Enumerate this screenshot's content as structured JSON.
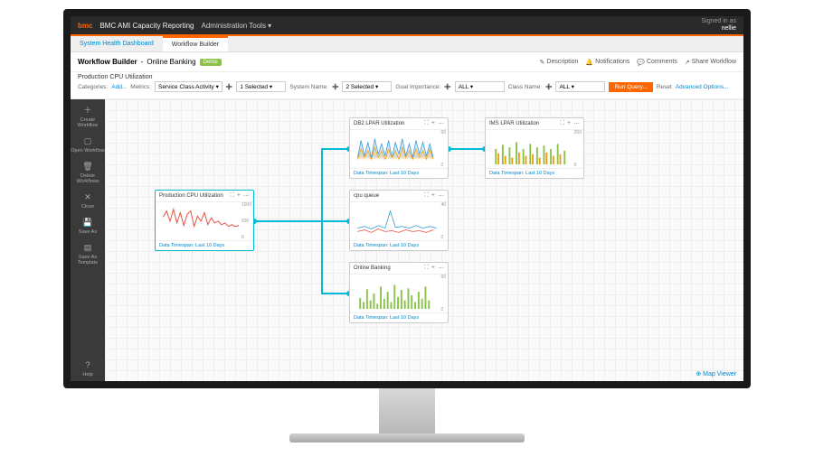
{
  "topbar": {
    "brand": "bmc",
    "title": "BMC AMI Capacity Reporting",
    "menu": "Administration Tools",
    "signin_label": "Signed in as",
    "user": "nellie"
  },
  "tabs": {
    "dashboard": "System Health Dashboard",
    "builder": "Workflow Builder"
  },
  "subheader": {
    "title": "Workflow Builder",
    "subtitle": "Online Banking",
    "badge": "Demo",
    "desc": "Description",
    "notif": "Notifications",
    "comments": "Comments",
    "share": "Share Workflow"
  },
  "filters": {
    "title": "Production CPU Utilization",
    "categories_label": "Categories:",
    "categories_link": "Add...",
    "metrics_label": "Metrics:",
    "service": "Service Class Activity",
    "service_count": "1 Selected",
    "sysname_label": "System Name:",
    "sysname": "2 Selected",
    "goal_label": "Goal Importance:",
    "goal": "ALL",
    "class_label": "Class Name:",
    "class": "ALL",
    "run": "Run Query...",
    "reset": "Reset",
    "adv": "Advanced Options..."
  },
  "sidebar": {
    "create": "Create Workflow",
    "open": "Open Workflow",
    "delete": "Delete Workflows",
    "close": "Close",
    "saveas": "Save As",
    "template": "Save As Template",
    "help": "Help"
  },
  "nodes": {
    "prod": {
      "title": "Production CPU Utilization",
      "footer": "Data Timespan: Last 10 Days",
      "ymax": "1000",
      "ymid": "500",
      "ymin": "0"
    },
    "db2": {
      "title": "DB2 LPAR Utilization",
      "footer": "Data Timespan: Last 10 Days",
      "ymax": "50",
      "ymin": "0"
    },
    "cpu": {
      "title": "cpu queue",
      "footer": "Data Timespan: Last 10 Days",
      "ymax": "40",
      "ymin": "0"
    },
    "online": {
      "title": "Online Banking",
      "footer": "Data Timespan: Last 10 Days",
      "ymax": "50",
      "ymin": "0"
    },
    "ims": {
      "title": "IMS LPAR Utilization",
      "footer": "Data Timespan: Last 10 Days",
      "ymax": "250",
      "ymin": "0"
    }
  },
  "footer": {
    "map": "Map Viewer"
  }
}
